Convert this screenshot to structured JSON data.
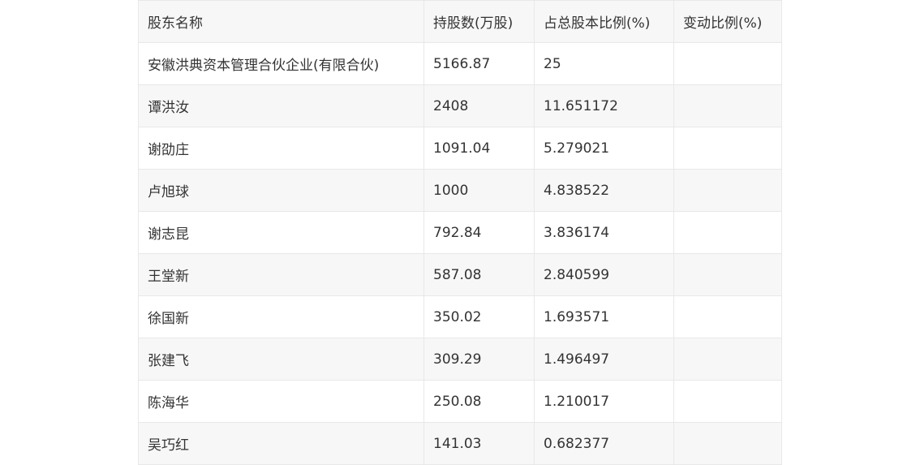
{
  "table": {
    "headers": [
      "股东名称",
      "持股数(万股)",
      "占总股本比例(%)",
      "变动比例(%)"
    ],
    "rows": [
      [
        "安徽洪典资本管理合伙企业(有限合伙)",
        "5166.87",
        "25",
        ""
      ],
      [
        "谭洪汝",
        "2408",
        "11.651172",
        ""
      ],
      [
        "谢劭庄",
        "1091.04",
        "5.279021",
        ""
      ],
      [
        "卢旭球",
        "1000",
        "4.838522",
        ""
      ],
      [
        "谢志昆",
        "792.84",
        "3.836174",
        ""
      ],
      [
        "王堂新",
        "587.08",
        "2.840599",
        ""
      ],
      [
        "徐国新",
        "350.02",
        "1.693571",
        ""
      ],
      [
        "张建飞",
        "309.29",
        "1.496497",
        ""
      ],
      [
        "陈海华",
        "250.08",
        "1.210017",
        ""
      ],
      [
        "吴巧红",
        "141.03",
        "0.682377",
        ""
      ]
    ]
  }
}
